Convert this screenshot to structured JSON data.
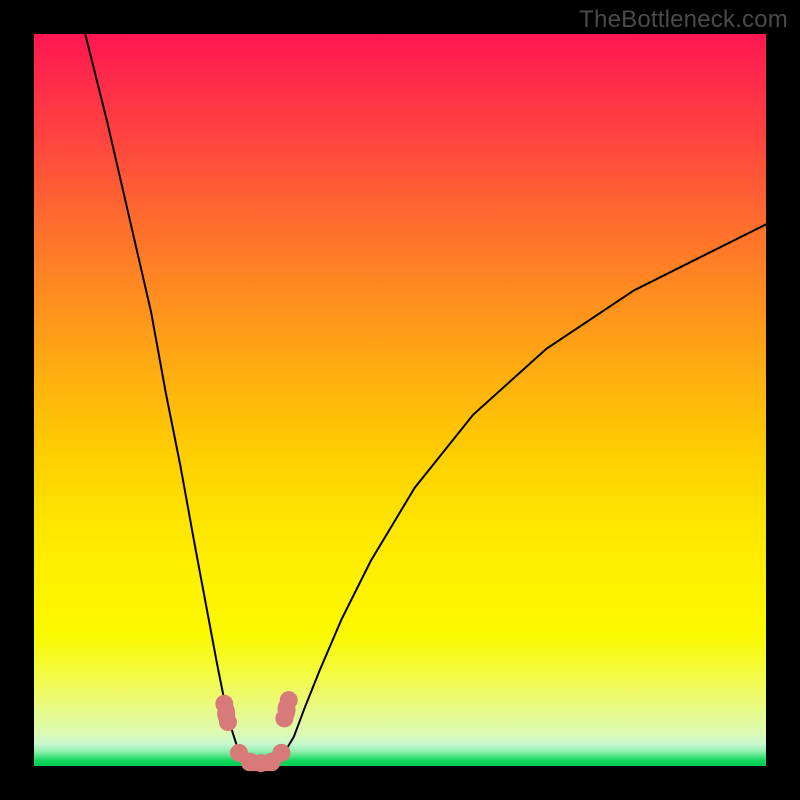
{
  "watermark": "TheBottleneck.com",
  "chart_data": {
    "type": "line",
    "title": "",
    "xlabel": "",
    "ylabel": "",
    "xlim": [
      0,
      100
    ],
    "ylim": [
      0,
      100
    ],
    "grid": false,
    "legend": false,
    "series": [
      {
        "name": "left-branch",
        "x": [
          7,
          10,
          13,
          16,
          18,
          20,
          22,
          23.5,
          25,
          26,
          27,
          27.8,
          28.5,
          29
        ],
        "y": [
          100,
          88,
          75,
          62,
          51,
          41,
          30,
          22,
          14,
          9,
          5,
          2.5,
          1,
          0.3
        ]
      },
      {
        "name": "right-branch",
        "x": [
          33,
          34,
          35.5,
          37,
          39,
          42,
          46,
          52,
          60,
          70,
          82,
          96,
          100
        ],
        "y": [
          0.3,
          1.5,
          4,
          8,
          13,
          20,
          28,
          38,
          48,
          57,
          65,
          72,
          74
        ]
      },
      {
        "name": "valley-floor",
        "x": [
          29,
          30,
          31,
          32,
          33
        ],
        "y": [
          0.3,
          0.1,
          0.05,
          0.1,
          0.3
        ]
      }
    ],
    "markers": {
      "color": "#d97a7a",
      "points": [
        {
          "x": 26.0,
          "y": 8.5
        },
        {
          "x": 26.5,
          "y": 6.0
        },
        {
          "x": 28.0,
          "y": 1.8
        },
        {
          "x": 29.5,
          "y": 0.6
        },
        {
          "x": 31.0,
          "y": 0.4
        },
        {
          "x": 32.5,
          "y": 0.6
        },
        {
          "x": 33.8,
          "y": 1.8
        },
        {
          "x": 34.2,
          "y": 6.5
        },
        {
          "x": 34.8,
          "y": 9.0
        }
      ]
    }
  }
}
